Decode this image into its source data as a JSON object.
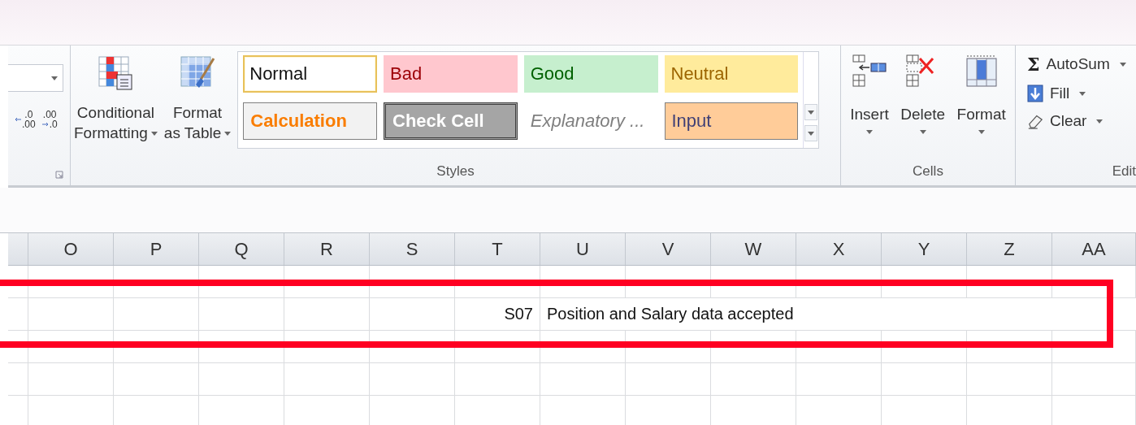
{
  "ribbon": {
    "number_group": {
      "decimal_buttons": [
        {
          "kind": "increase",
          "top": ".0",
          "bottom": ".00"
        },
        {
          "kind": "decrease",
          "top": ".00",
          "bottom": ".0"
        }
      ]
    },
    "styles_group": {
      "label": "Styles",
      "buttons": [
        {
          "kind": "conditional",
          "lines": [
            "Conditional",
            "Formatting"
          ]
        },
        {
          "kind": "table",
          "lines": [
            "Format",
            "as Table"
          ]
        }
      ],
      "cell_styles": [
        {
          "label": "Normal",
          "kind": "normal",
          "selected": true
        },
        {
          "label": "Bad",
          "kind": "bad",
          "selected": false
        },
        {
          "label": "Good",
          "kind": "good",
          "selected": false
        },
        {
          "label": "Neutral",
          "kind": "neutral",
          "selected": false
        },
        {
          "label": "Calculation",
          "kind": "calculation",
          "selected": false
        },
        {
          "label": "Check Cell",
          "kind": "check",
          "selected": false
        },
        {
          "label": "Explanatory ...",
          "kind": "explanatory",
          "selected": false
        },
        {
          "label": "Input",
          "kind": "input",
          "selected": false
        }
      ]
    },
    "cells_group": {
      "label": "Cells",
      "buttons": [
        {
          "kind": "insert",
          "label": "Insert"
        },
        {
          "kind": "delete",
          "label": "Delete"
        },
        {
          "kind": "format",
          "label": "Format"
        }
      ]
    },
    "editing_group": {
      "label": "Edit",
      "buttons": [
        {
          "kind": "sum",
          "icon": "Σ",
          "label": "AutoSum"
        },
        {
          "kind": "fill",
          "label": "Fill"
        },
        {
          "kind": "clear",
          "label": "Clear"
        }
      ]
    }
  },
  "sheet": {
    "columns": [
      "O",
      "P",
      "Q",
      "R",
      "S",
      "T",
      "U",
      "V",
      "W",
      "X",
      "Y",
      "Z",
      "AA"
    ],
    "entry_row": {
      "cells": [
        null,
        null,
        null,
        null,
        null,
        {
          "kind": "number",
          "text": "S07"
        },
        {
          "kind": "text",
          "text": "Position and Salary data accepted"
        }
      ]
    }
  }
}
